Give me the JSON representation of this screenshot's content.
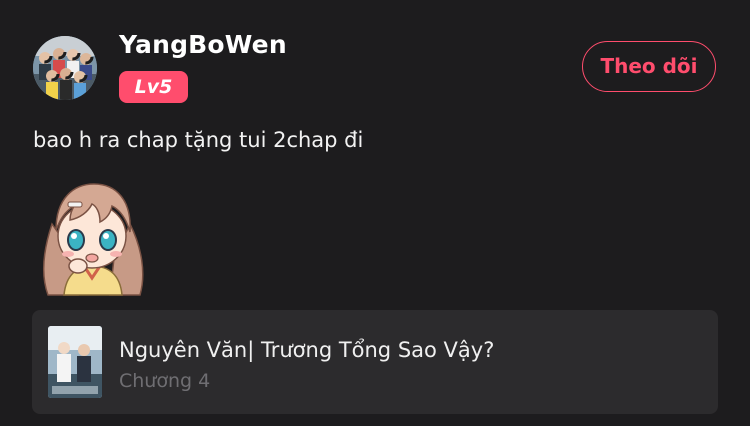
{
  "user": {
    "name": "YangBoWen",
    "level": "Lv5",
    "avatar_icon": "group-photo-avatar"
  },
  "follow_button": {
    "label": "Theo dõi"
  },
  "comment": {
    "text": "bao h ra chap tặng tui 2chap đi",
    "sticker_icon": "anime-girl-sticker"
  },
  "linked_manga": {
    "title": "Nguyên Văn| Trương Tổng Sao Vậy?",
    "chapter": "Chương 4",
    "cover_icon": "manga-cover"
  },
  "colors": {
    "background": "#1d1c1e",
    "accent": "#ff4d6d",
    "card": "#2c2b2d",
    "muted_text": "#6f6e72"
  }
}
